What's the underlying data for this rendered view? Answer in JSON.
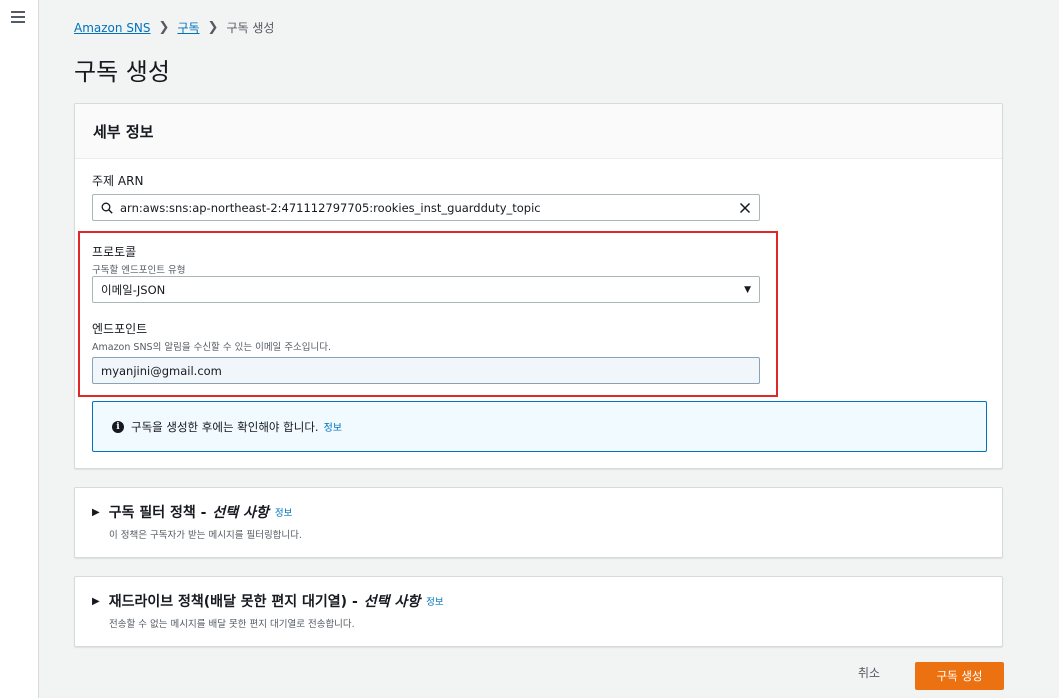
{
  "breadcrumb": {
    "root": "Amazon SNS",
    "middle": "구독",
    "current": "구독 생성"
  },
  "page_title": "구독 생성",
  "details": {
    "heading": "세부 정보",
    "topic_arn": {
      "label": "주제 ARN",
      "value": "arn:aws:sns:ap-northeast-2:471112797705:rookies_inst_guardduty_topic"
    },
    "protocol": {
      "label": "프로토콜",
      "description": "구독할 엔드포인트 유형",
      "value": "이메일-JSON"
    },
    "endpoint": {
      "label": "엔드포인트",
      "description": "Amazon SNS의 알림을 수신할 수 있는 이메일 주소입니다.",
      "value": "myanjini@gmail.com"
    },
    "info_message": "구독을 생성한 후에는 확인해야 합니다.",
    "info_link": "정보"
  },
  "filter_policy": {
    "title": "구독 필터 정책 -",
    "optional": "선택 사항",
    "info_link": "정보",
    "description": "이 정책은 구독자가 받는 메시지를 필터링합니다."
  },
  "redrive_policy": {
    "title": "재드라이브 정책(배달 못한 편지 대기열) -",
    "optional": "선택 사항",
    "info_link": "정보",
    "description": "전송할 수 없는 메시지를 배달 못한 편지 대기열로 전송합니다."
  },
  "actions": {
    "cancel": "취소",
    "create": "구독 생성"
  },
  "colors": {
    "accent": "#ec7211",
    "link": "#0073bb",
    "highlight": "#e02828"
  }
}
